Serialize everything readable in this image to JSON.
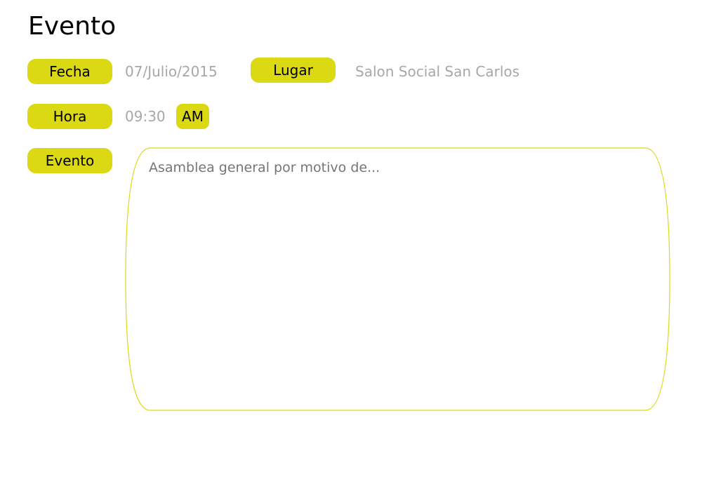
{
  "page": {
    "title": "Evento"
  },
  "form": {
    "fecha": {
      "label": "Fecha",
      "value": "07/Julio/2015"
    },
    "lugar": {
      "label": "Lugar",
      "value": "Salon Social San Carlos"
    },
    "hora": {
      "label": "Hora",
      "value": "09:30",
      "period": "AM"
    },
    "evento": {
      "label": "Evento",
      "value": "Asamblea general por motivo de..."
    }
  },
  "colors": {
    "accent": "#dbd814",
    "value_text": "#a8a8a8",
    "border": "#dbd814"
  }
}
